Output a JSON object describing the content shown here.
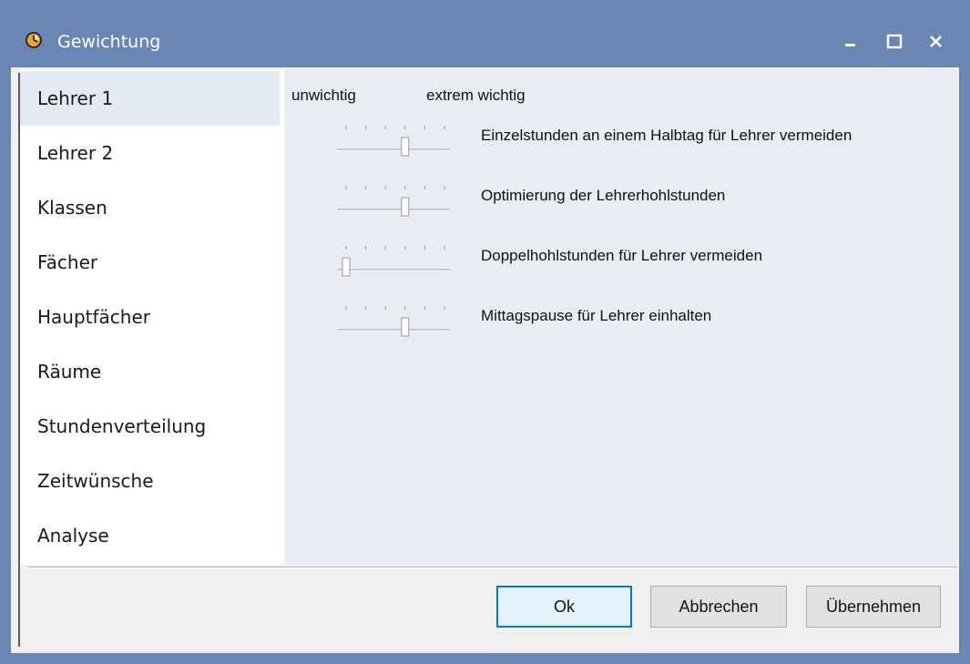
{
  "window": {
    "title": "Gewichtung",
    "icon": "clock-icon",
    "controls": [
      "minimize-icon",
      "maximize-icon",
      "close-icon"
    ]
  },
  "sidebar": {
    "items": [
      {
        "label": "Lehrer 1",
        "selected": true
      },
      {
        "label": "Lehrer 2",
        "selected": false
      },
      {
        "label": "Klassen",
        "selected": false
      },
      {
        "label": "Fächer",
        "selected": false
      },
      {
        "label": "Hauptfächer",
        "selected": false
      },
      {
        "label": "Räume",
        "selected": false
      },
      {
        "label": "Stundenverteilung",
        "selected": false
      },
      {
        "label": "Zeitwünsche",
        "selected": false
      },
      {
        "label": "Analyse",
        "selected": false
      }
    ]
  },
  "scale": {
    "low_label": "unwichtig",
    "high_label": "extrem wichtig"
  },
  "options": [
    {
      "label": "Einzelstunden an einem Halbtag für Lehrer vermeiden",
      "level": 3,
      "max": 5
    },
    {
      "label": "Optimierung der Lehrerhohlstunden",
      "level": 3,
      "max": 5
    },
    {
      "label": "Doppelhohlstunden für Lehrer vermeiden",
      "level": 0,
      "max": 5
    },
    {
      "label": "Mittagspause für Lehrer einhalten",
      "level": 3,
      "max": 5
    }
  ],
  "buttons": {
    "ok": "Ok",
    "cancel": "Abbrechen",
    "apply": "Übernehmen"
  },
  "colors": {
    "titlebar": "#6a87b3",
    "selection": "#e5e9f1",
    "default_button_border": "#0078d7"
  }
}
